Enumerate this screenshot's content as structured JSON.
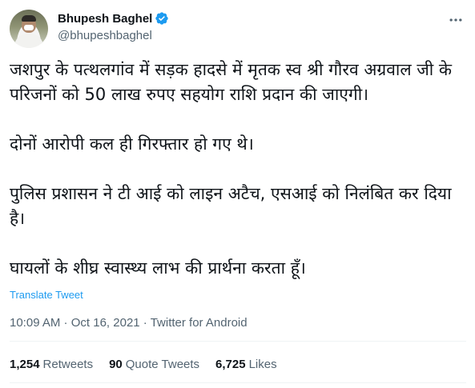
{
  "header": {
    "display_name": "Bhupesh Baghel",
    "handle": "@bhupeshbaghel",
    "verified_color": "#1d9bf0"
  },
  "tweet": {
    "paragraphs": [
      "जशपुर के पत्थलगांव में सड़क हादसे में मृतक स्व श्री गौरव अग्रवाल जी के परिजनों को 50 लाख रुपए सहयोग राशि प्रदान की जाएगी।",
      "दोनों आरोपी कल ही गिरफ्तार हो गए थे।",
      "पुलिस प्रशासन ने टी आई को लाइन अटैच, एसआई को निलंबित कर दिया है।",
      "घायलों के शीघ्र स्वास्थ्य लाभ की प्रार्थना करता हूँ।"
    ],
    "translate_label": "Translate Tweet"
  },
  "meta": {
    "time": "10:09 AM",
    "separator": " · ",
    "date": "Oct 16, 2021",
    "source": "Twitter for Android"
  },
  "stats": {
    "retweets_count": "1,254",
    "retweets_label": "Retweets",
    "quotes_count": "90",
    "quotes_label": "Quote Tweets",
    "likes_count": "6,725",
    "likes_label": "Likes"
  },
  "icons": {
    "avatar": "profile-photo",
    "verified": "verified-badge-icon",
    "more": "more-options-icon"
  }
}
